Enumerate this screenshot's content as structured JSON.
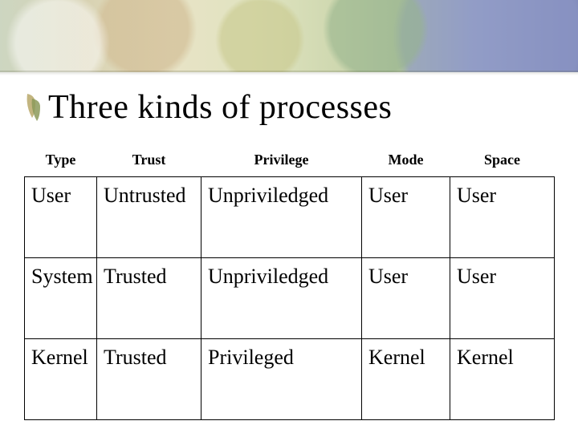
{
  "title": "Three kinds of processes",
  "chart_data": {
    "type": "table",
    "headers": [
      "Type",
      "Trust",
      "Privilege",
      "Mode",
      "Space"
    ],
    "rows": [
      {
        "type": "User",
        "trust": "Untrusted",
        "privilege": "Unpriviledged",
        "mode": "User",
        "space": "User"
      },
      {
        "type": "System",
        "trust": "Trusted",
        "privilege": "Unpriviledged",
        "mode": "User",
        "space": "User"
      },
      {
        "type": "Kernel",
        "trust": "Trusted",
        "privilege": "Privileged",
        "mode": "Kernel",
        "space": "Kernel"
      }
    ]
  }
}
